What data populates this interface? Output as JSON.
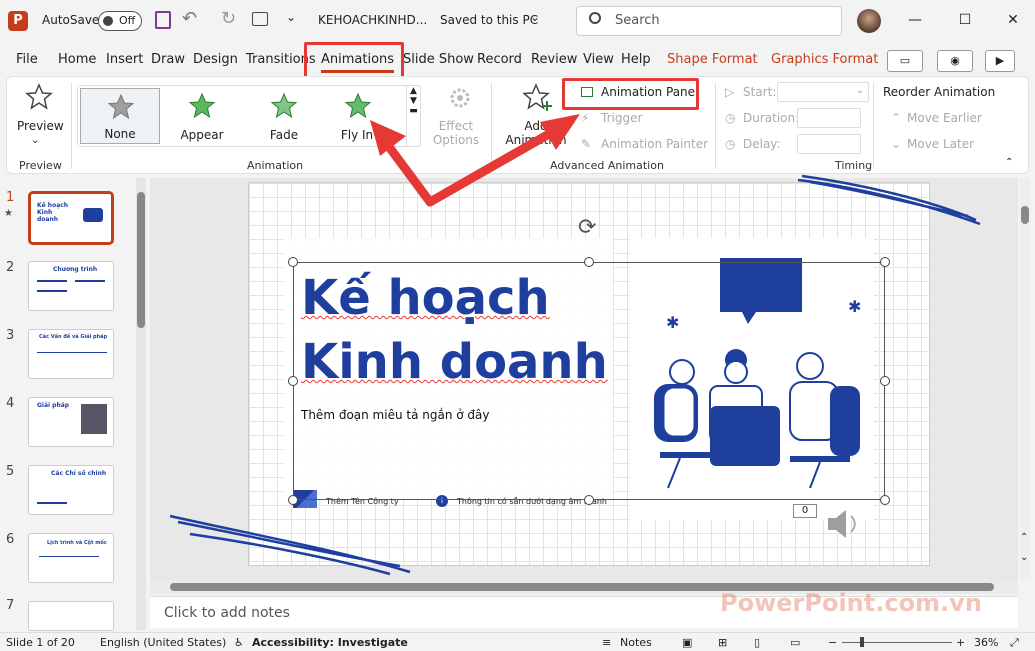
{
  "titlebar": {
    "logo": "P",
    "autosave_label": "AutoSave",
    "autosave_state": "Off",
    "filename": "KEHOACHKINHD...",
    "save_status": "Saved to this PC",
    "search_placeholder": "Search"
  },
  "menu": {
    "items": [
      "File",
      "Home",
      "Insert",
      "Draw",
      "Design",
      "Transitions",
      "Animations",
      "Slide Show",
      "Record",
      "Review",
      "View",
      "Help",
      "Shape Format",
      "Graphics Format"
    ],
    "active": "Animations"
  },
  "ribbon": {
    "preview": {
      "label": "Preview",
      "group": "Preview"
    },
    "animation_gallery": [
      "None",
      "Appear",
      "Fade",
      "Fly In"
    ],
    "effect_options": "Effect Options",
    "animation_group": "Animation",
    "add_animation": "Add Animation",
    "animation_pane": "Animation Pane",
    "trigger": "Trigger",
    "animation_painter": "Animation Painter",
    "advanced_group": "Advanced Animation",
    "start_label": "Start:",
    "duration_label": "Duration:",
    "delay_label": "Delay:",
    "timing_group": "Timing",
    "reorder_title": "Reorder Animation",
    "move_earlier": "Move Earlier",
    "move_later": "Move Later"
  },
  "thumbnails": [
    {
      "num": "1",
      "title": "Kế hoạch Kinh doanh"
    },
    {
      "num": "2",
      "title": "Chương trình"
    },
    {
      "num": "3",
      "title": "Các Vấn đề và Giải pháp"
    },
    {
      "num": "4",
      "title": "Giải pháp"
    },
    {
      "num": "5",
      "title": "Các Chỉ số chính"
    },
    {
      "num": "6",
      "title": "Lịch trình và Cột mốc"
    },
    {
      "num": "7",
      "title": ""
    }
  ],
  "slide": {
    "title_line1": "Kế hoạch",
    "title_line2": "Kinh doanh",
    "subtitle": "Thêm đoạn miêu tả ngắn ở đây",
    "company": "Thêm Tên Công ty",
    "info": "Thông tin có sẵn dưới dạng âm thanh",
    "counter": "0"
  },
  "notes": {
    "placeholder": "Click to add notes"
  },
  "status": {
    "slide": "Slide 1 of 20",
    "language": "English (United States)",
    "accessibility": "Accessibility: Investigate",
    "notes": "Notes",
    "zoom": "36%"
  },
  "watermark": "PowerPoint.com.vn",
  "colors": {
    "accent": "#c43e1c",
    "highlight": "#e53935",
    "brand_blue": "#1f3f9f"
  }
}
